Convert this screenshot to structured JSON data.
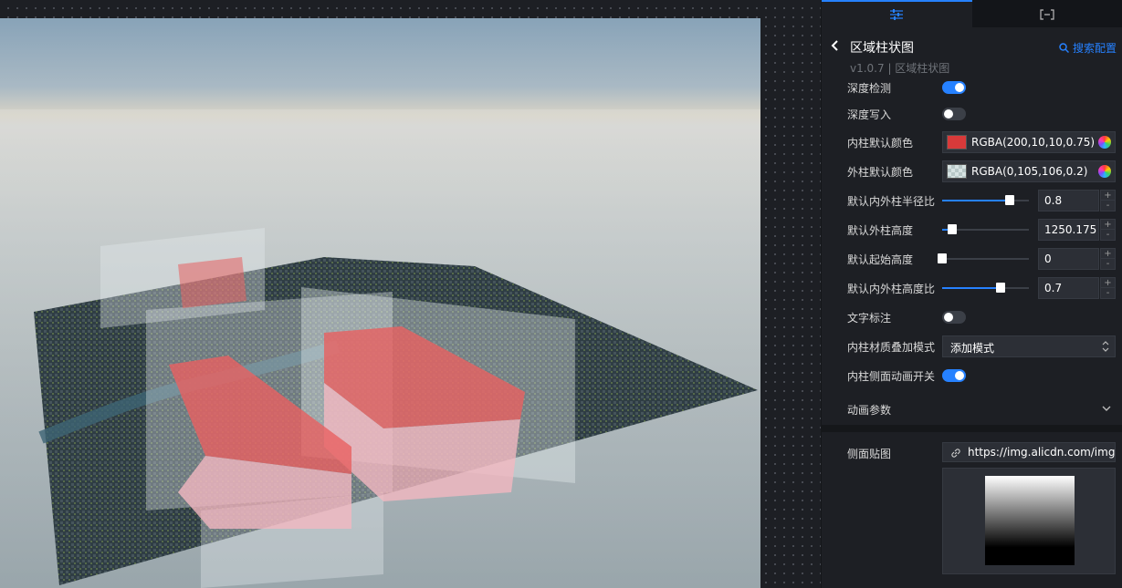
{
  "tabs": [
    {
      "name": "settings",
      "icon": "sliders-icon",
      "active": true
    },
    {
      "name": "code",
      "icon": "bracket-icon",
      "active": false
    }
  ],
  "header": {
    "title": "区域柱状图",
    "search_label": "搜索配置",
    "version": "v1.0.7 | 区域柱状图"
  },
  "fields": {
    "depth_test": {
      "label": "深度检测",
      "on": true
    },
    "depth_write": {
      "label": "深度写入",
      "on": false
    },
    "inner_color": {
      "label": "内柱默认颜色",
      "value": "RGBA(200,10,10,0.75)",
      "color": "#d83a3a"
    },
    "outer_color": {
      "label": "外柱默认颜色",
      "value": "RGBA(0,105,106,0.2)",
      "color": "#d7e3e3"
    },
    "radius_ratio": {
      "label": "默认内外柱半径比",
      "value": "0.8",
      "fraction": 0.78
    },
    "outer_height": {
      "label": "默认外柱高度",
      "value": "1250.175",
      "fraction": 0.12
    },
    "start_height": {
      "label": "默认起始高度",
      "value": "0",
      "fraction": 0.0
    },
    "height_ratio": {
      "label": "默认内外柱高度比",
      "value": "0.7",
      "fraction": 0.67
    },
    "text_label": {
      "label": "文字标注",
      "on": false
    },
    "blend_mode": {
      "label": "内柱材质叠加模式",
      "value": "添加模式"
    },
    "side_anim": {
      "label": "内柱侧面动画开关",
      "on": true
    },
    "anim_params": {
      "label": "动画参数"
    },
    "side_texture": {
      "label": "侧面贴图",
      "url": "https://img.alicdn.com/imgextra/"
    }
  },
  "stepper": {
    "plus": "+",
    "minus": "-"
  },
  "colors": {
    "accent": "#2681ff",
    "panel_bg": "#1d1f24"
  }
}
